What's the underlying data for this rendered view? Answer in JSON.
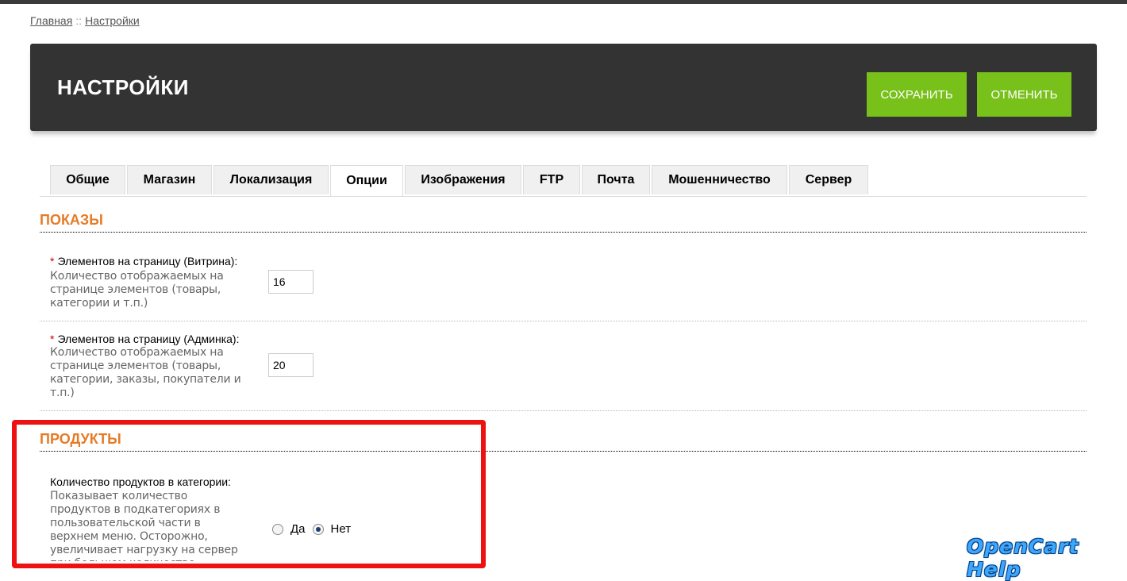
{
  "breadcrumb": {
    "home": "Главная",
    "separator": "::",
    "current": "Настройки"
  },
  "header": {
    "title": "НАСТРОЙКИ",
    "save_label": "Сохранить",
    "cancel_label": "Отменить"
  },
  "tabs": [
    {
      "label": "Общие",
      "active": false
    },
    {
      "label": "Магазин",
      "active": false
    },
    {
      "label": "Локализация",
      "active": false
    },
    {
      "label": "Опции",
      "active": true
    },
    {
      "label": "Изображения",
      "active": false
    },
    {
      "label": "FTP",
      "active": false
    },
    {
      "label": "Почта",
      "active": false
    },
    {
      "label": "Мошенничество",
      "active": false
    },
    {
      "label": "Сервер",
      "active": false
    }
  ],
  "sections": {
    "display": {
      "title": "Показы",
      "fields": [
        {
          "required_mark": "*",
          "label": "Элементов на страницу (Витрина):",
          "help": "Количество отображаемых на странице элементов (товары, категории и т.п.)",
          "value": "16"
        },
        {
          "required_mark": "*",
          "label": "Элементов на страницу (Админка):",
          "help": "Количество отображаемых на странице элементов (товары, категории, заказы, покупатели и т.п.)",
          "value": "20"
        }
      ]
    },
    "products": {
      "title": "Продукты",
      "fields": [
        {
          "label": "Количество продуктов в категории:",
          "help": "Показывает количество продуктов в подкатегориях в пользовательской части в верхнем меню. Осторожно, увеличивает нагрузку на сервер при большом количестве",
          "options": [
            {
              "label": "Да",
              "checked": false
            },
            {
              "label": "Нет",
              "checked": true
            }
          ]
        }
      ]
    }
  },
  "watermark": "OpenCart Help",
  "colors": {
    "accent": "#e67b26",
    "button_green": "#78c11a",
    "header_bg": "#333333",
    "highlight_border": "#ee1111",
    "required": "#cc0000"
  }
}
